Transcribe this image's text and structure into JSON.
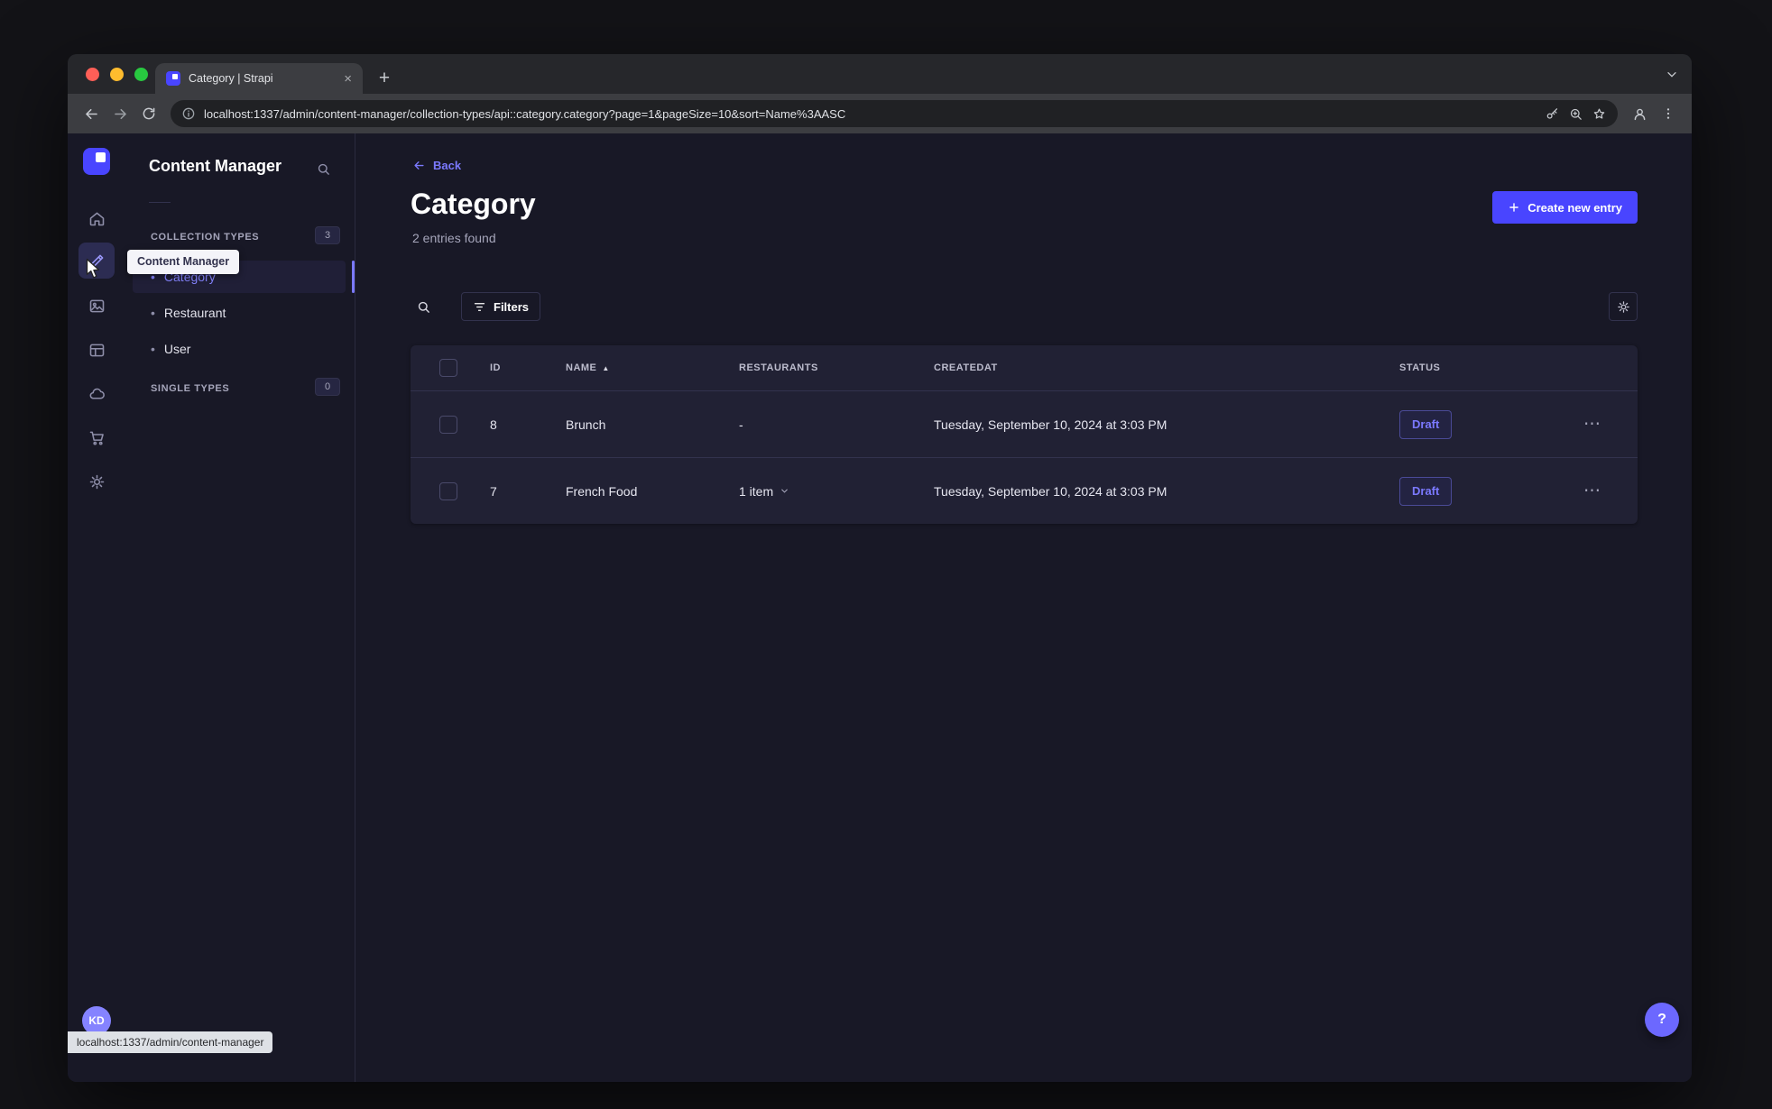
{
  "browser": {
    "tab_title": "Category | Strapi",
    "close_glyph": "×",
    "new_tab_glyph": "+",
    "url": "localhost:1337/admin/content-manager/collection-types/api::category.category?page=1&pageSize=10&sort=Name%3AASC",
    "status_bubble": "localhost:1337/admin/content-manager"
  },
  "rail": {
    "tooltip": "Content Manager",
    "avatar": "KD"
  },
  "sidebar": {
    "title": "Content Manager",
    "collection_types_label": "COLLECTION TYPES",
    "collection_types_count": "3",
    "single_types_label": "SINGLE TYPES",
    "single_types_count": "0",
    "bullet": "•",
    "items": [
      {
        "label": "Category"
      },
      {
        "label": "Restaurant"
      },
      {
        "label": "User"
      }
    ]
  },
  "main": {
    "back": "Back",
    "title": "Category",
    "subtitle": "2 entries found",
    "create": "Create new entry",
    "filters": "Filters",
    "sort_glyph": "▲",
    "kebab": "⋯",
    "help": "?",
    "table": {
      "headers": {
        "id": "ID",
        "name": "NAME",
        "restaurants": "RESTAURANTS",
        "created": "CREATEDAT",
        "status": "STATUS"
      },
      "rows": [
        {
          "id": "8",
          "name": "Brunch",
          "restaurants": "-",
          "created": "Tuesday, September 10, 2024 at 3:03 PM",
          "status": "Draft"
        },
        {
          "id": "7",
          "name": "French Food",
          "restaurants": "1 item",
          "created": "Tuesday, September 10, 2024 at 3:03 PM",
          "status": "Draft"
        }
      ]
    }
  },
  "colors": {
    "accent": "#4945ff",
    "link": "#7b79ff",
    "app_bg": "#181826",
    "card_bg": "#212134",
    "border": "#32324d"
  }
}
